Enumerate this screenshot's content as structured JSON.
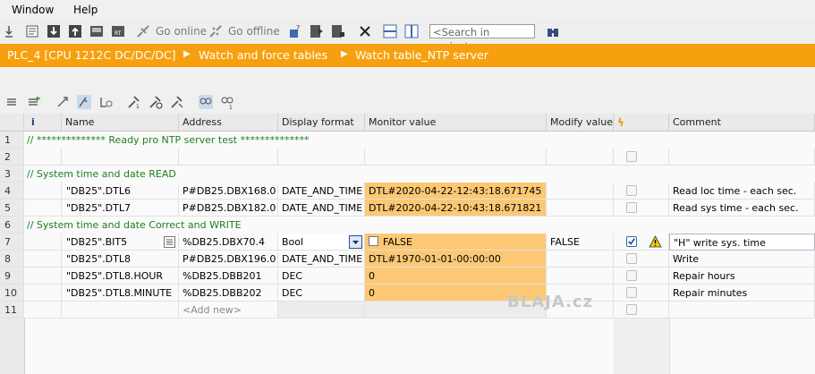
{
  "menu": [
    "Window",
    "Help"
  ],
  "toolbar": {
    "go_online": "Go online",
    "go_offline": "Go offline",
    "search_placeholder": "<Search in project>"
  },
  "breadcrumb": [
    "PLC_4 [CPU 1212C DC/DC/DC]",
    "Watch and force tables",
    "Watch table_NTP server"
  ],
  "table": {
    "headers": {
      "info": "i",
      "name": "Name",
      "address": "Address",
      "format": "Display format",
      "monitor": "Monitor value",
      "modify": "Modify value",
      "comment": "Comment"
    },
    "rows": [
      {
        "n": "1",
        "line": "// ************** Ready pro NTP server test **************"
      },
      {
        "n": "2"
      },
      {
        "n": "3",
        "line": "// System time and date READ"
      },
      {
        "n": "4",
        "name": "\"DB25\".DTL6",
        "address": "P#DB25.DBX168.0",
        "format": "DATE_AND_TIME",
        "monitor": "DTL#2020-04-22-12:43:18.671745",
        "comment": "Read loc time - each sec."
      },
      {
        "n": "5",
        "name": "\"DB25\".DTL7",
        "address": "P#DB25.DBX182.0",
        "format": "DATE_AND_TIME",
        "monitor": "DTL#2020-04-22-10:43:18.671821",
        "comment": "Read sys time - each sec."
      },
      {
        "n": "6",
        "line": "// System time and date Correct and WRITE"
      },
      {
        "n": "7",
        "name": "\"DB25\".BIT5",
        "address": "%DB25.DBX70.4",
        "format": "Bool",
        "monitor": "FALSE",
        "modify": "FALSE",
        "comment": "\"H\" write sys. time"
      },
      {
        "n": "8",
        "name": "\"DB25\".DTL8",
        "address": "P#DB25.DBX196.0",
        "format": "DATE_AND_TIME",
        "monitor": "DTL#1970-01-01-00:00:00",
        "comment": "Write"
      },
      {
        "n": "9",
        "name": "\"DB25\".DTL8.HOUR",
        "address": "%DB25.DBB201",
        "format": "DEC",
        "monitor": "0",
        "comment": "Repair hours"
      },
      {
        "n": "10",
        "name": "\"DB25\".DTL8.MINUTE",
        "address": "%DB25.DBB202",
        "format": "DEC",
        "monitor": "0",
        "comment": "Repair minutes"
      },
      {
        "n": "11",
        "address": "<Add new>"
      }
    ]
  },
  "watermark": "BLAJA.cz",
  "colors": {
    "accent": "#f7a00f",
    "monitor_bg": "#fcc873",
    "comment_green": "#1f7d1f"
  }
}
